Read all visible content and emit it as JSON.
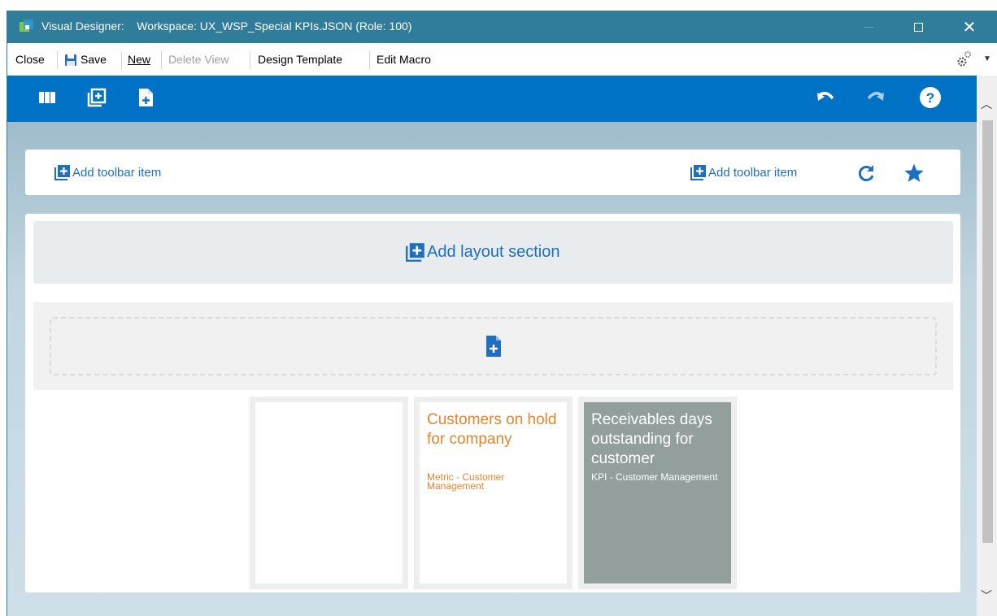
{
  "window": {
    "title_app": "Visual Designer:",
    "title_workspace": "Workspace: UX_WSP_Special KPIs.JSON (Role: 100)",
    "close_glyph": "✕"
  },
  "menu": {
    "close": "Close",
    "save": "Save",
    "new": "New",
    "delete_view": "Delete View",
    "design_template": "Design Template",
    "edit_macro": "Edit Macro"
  },
  "toolbar": {
    "icons": [
      "columns-icon",
      "add-section-icon",
      "add-file-icon",
      "undo-icon",
      "redo-icon",
      "help-icon"
    ]
  },
  "page_toolbar": {
    "left_add": "Add toolbar item",
    "right_add": "Add toolbar item"
  },
  "layout": {
    "add_section": "Add layout section"
  },
  "tiles": [
    {
      "title": "",
      "subtitle": ""
    },
    {
      "title": "Customers on hold for company",
      "subtitle": "Metric - Customer Management"
    },
    {
      "title": "Receivables days outstanding for customer",
      "subtitle": "KPI - Customer Management"
    }
  ],
  "colors": {
    "titlebar": "#2f7d9b",
    "toolbar": "#0072c6",
    "link": "#1e6fbf",
    "metric_orange": "#e6842e",
    "kpi_gray": "#939f9d"
  }
}
